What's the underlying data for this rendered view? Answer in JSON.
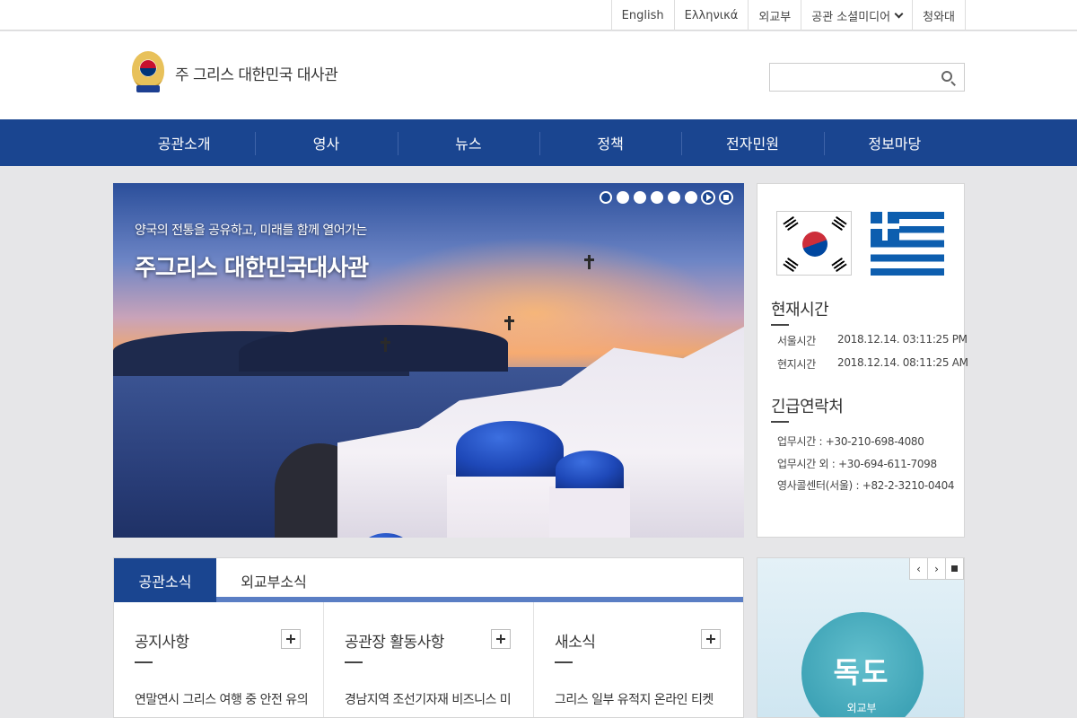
{
  "topbar": {
    "links": [
      "English",
      "Ελληνικά",
      "외교부",
      "공관 소셜미디어",
      "청와대"
    ]
  },
  "header": {
    "site_title": "주 그리스 대한민국 대사관",
    "search": {
      "placeholder": "",
      "value": ""
    }
  },
  "nav": {
    "items": [
      "공관소개",
      "영사",
      "뉴스",
      "정책",
      "전자민원",
      "정보마당"
    ],
    "color": "#1a4590"
  },
  "hero": {
    "subtitle": "양국의 전통을 공유하고, 미래를 함께 열어가는",
    "title": "주그리스 대한민국대사관",
    "slide_count": 6,
    "active_slide": 1
  },
  "side": {
    "time_heading": "현재시간",
    "times": [
      {
        "label": "서울시간",
        "value": "2018.12.14. 03:11:25 PM"
      },
      {
        "label": "현지시간",
        "value": "2018.12.14. 08:11:25 AM"
      }
    ],
    "contact_heading": "긴급연락처",
    "contacts": [
      "업무시간 : +30-210-698-4080",
      "업무시간 외 : +30-694-611-7098",
      "영사콜센터(서울) : +82-2-3210-0404"
    ]
  },
  "news": {
    "tabs": [
      "공관소식",
      "외교부소식"
    ],
    "active_tab": 0,
    "columns": [
      {
        "heading": "공지사항",
        "item": "연말연시 그리스 여행 중 안전 유의"
      },
      {
        "heading": "공관장 활동사항",
        "item": "경남지역 조선기자재 비즈니스 미"
      },
      {
        "heading": "새소식",
        "item": "그리스 일부 유적지 온라인 티켓"
      }
    ]
  },
  "banner": {
    "title": "독도",
    "caption": "외교부",
    "controls": [
      "‹",
      "›"
    ]
  }
}
